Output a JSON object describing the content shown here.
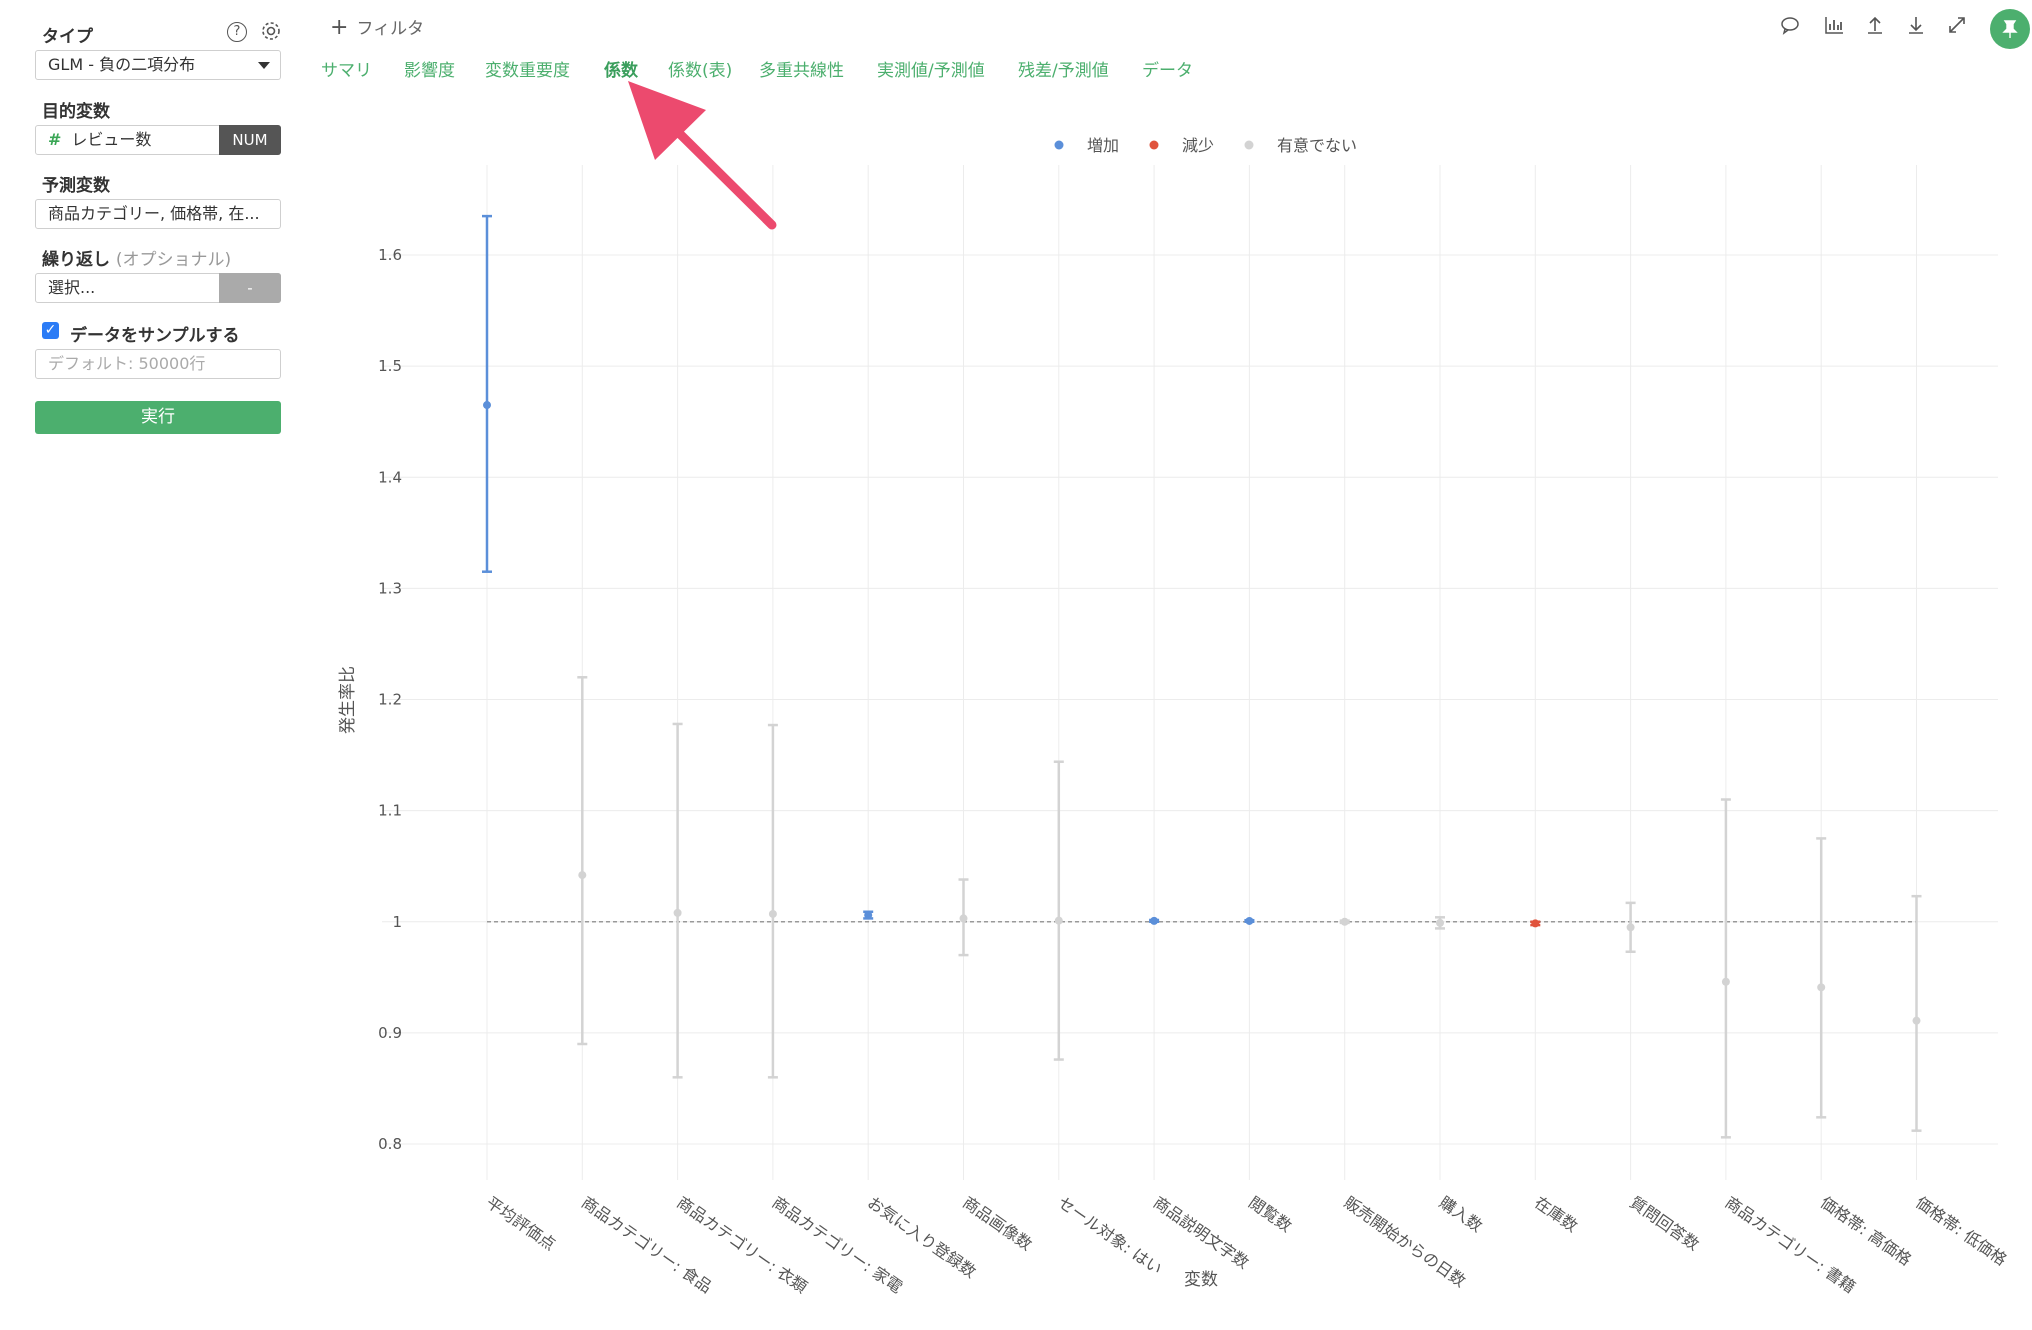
{
  "sidebar": {
    "type_label": "タイプ",
    "type_value": "GLM - 負の二項分布",
    "target_label": "目的変数",
    "target_value": "レビュー数",
    "target_hash": "#",
    "target_type": "NUM",
    "predictor_label": "予測変数",
    "predictor_value": "商品カテゴリー, 価格帯, 在...",
    "repeat_label": "繰り返し",
    "repeat_optional": "(オプショナル)",
    "repeat_placeholder": "選択...",
    "repeat_button": "-",
    "sample_label": "データをサンプルする",
    "sample_placeholder": "デフォルト: 50000行",
    "run_label": "実行",
    "help_icon": "?"
  },
  "topbar": {
    "filter_label": "フィルタ",
    "tabs": [
      "サマリ",
      "影響度",
      "変数重要度",
      "係数",
      "係数(表)",
      "多重共線性",
      "実測値/予測値",
      "残差/予測値",
      "データ"
    ],
    "active_tab": "係数"
  },
  "colors": {
    "increase": "#5b8fd9",
    "decrease": "#e0533c",
    "not_significant": "#d3d3d3",
    "accent": "#4caf6e",
    "arrow": "#ec4a6e"
  },
  "chart_data": {
    "type": "scatter",
    "subtype": "errorbar",
    "xlabel": "変数",
    "ylabel": "発生率比",
    "ylim": [
      0.76,
      1.68
    ],
    "yticks": [
      0.8,
      0.9,
      1,
      1.1,
      1.2,
      1.3,
      1.4,
      1.5,
      1.6
    ],
    "reference_line": 1,
    "legend": [
      {
        "name": "増加",
        "key": "increase"
      },
      {
        "name": "減少",
        "key": "decrease"
      },
      {
        "name": "有意でない",
        "key": "not_significant"
      }
    ],
    "legend_position": "top",
    "points": [
      {
        "label": "平均評価点",
        "value": 1.465,
        "low": 1.315,
        "high": 1.635,
        "group": "increase"
      },
      {
        "label": "商品カテゴリー: 食品",
        "value": 1.042,
        "low": 0.89,
        "high": 1.22,
        "group": "not_significant"
      },
      {
        "label": "商品カテゴリー: 衣類",
        "value": 1.008,
        "low": 0.86,
        "high": 1.178,
        "group": "not_significant"
      },
      {
        "label": "商品カテゴリー: 家電",
        "value": 1.007,
        "low": 0.86,
        "high": 1.177,
        "group": "not_significant"
      },
      {
        "label": "お気に入り登録数",
        "value": 1.006,
        "low": 1.003,
        "high": 1.009,
        "group": "increase"
      },
      {
        "label": "商品画像数",
        "value": 1.003,
        "low": 0.97,
        "high": 1.038,
        "group": "not_significant"
      },
      {
        "label": "セール対象: はい",
        "value": 1.001,
        "low": 0.876,
        "high": 1.144,
        "group": "not_significant"
      },
      {
        "label": "商品説明文字数",
        "value": 1.0008,
        "low": 1.0,
        "high": 1.0016,
        "group": "increase"
      },
      {
        "label": "閲覧数",
        "value": 1.0007,
        "low": 1.0,
        "high": 1.0014,
        "group": "increase"
      },
      {
        "label": "販売開始からの日数",
        "value": 1.0,
        "low": 0.999,
        "high": 1.001,
        "group": "not_significant"
      },
      {
        "label": "購入数",
        "value": 0.999,
        "low": 0.994,
        "high": 1.004,
        "group": "not_significant"
      },
      {
        "label": "在庫数",
        "value": 0.9985,
        "low": 0.997,
        "high": 1.0,
        "group": "decrease"
      },
      {
        "label": "質問回答数",
        "value": 0.995,
        "low": 0.973,
        "high": 1.017,
        "group": "not_significant"
      },
      {
        "label": "商品カテゴリー: 書籍",
        "value": 0.946,
        "low": 0.806,
        "high": 1.11,
        "group": "not_significant"
      },
      {
        "label": "価格帯: 高価格",
        "value": 0.941,
        "low": 0.824,
        "high": 1.075,
        "group": "not_significant"
      },
      {
        "label": "価格帯: 低価格",
        "value": 0.911,
        "low": 0.812,
        "high": 1.023,
        "group": "not_significant"
      }
    ]
  }
}
